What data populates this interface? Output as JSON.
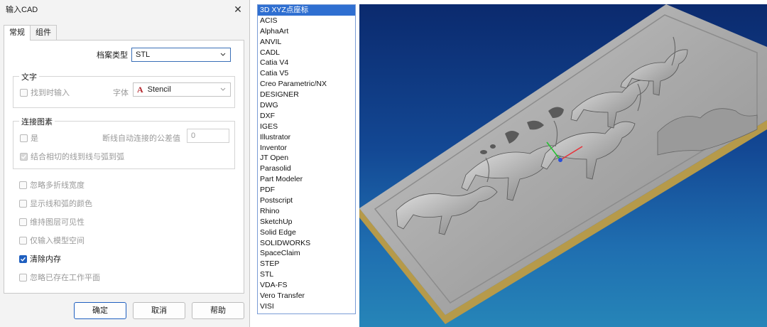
{
  "dialog": {
    "title": "输入CAD",
    "tabs": [
      {
        "label": "常规"
      },
      {
        "label": "组件"
      }
    ],
    "file_type": {
      "label": "档案类型",
      "value": "STL"
    },
    "text_group": {
      "title": "文字",
      "find_on_import": "找到时输入",
      "font_label": "字体",
      "font_value": "Stencil"
    },
    "connect_group": {
      "title": "连接图素",
      "yes": "是",
      "tolerance_label": "断线自动连接的公差值",
      "tolerance_value": "0",
      "combine_tangent": "结合相切的线到线与弧到弧"
    },
    "options": [
      {
        "label": "忽略多折线宽度",
        "checked": false
      },
      {
        "label": "显示线和弧的颜色",
        "checked": false
      },
      {
        "label": "维持图层可见性",
        "checked": false
      },
      {
        "label": "仅输入模型空间",
        "checked": false
      },
      {
        "label": "清除内存",
        "checked": true
      },
      {
        "label": "忽略已存在工作平面",
        "checked": false
      }
    ],
    "buttons": {
      "ok": "确定",
      "cancel": "取消",
      "help": "帮助"
    }
  },
  "format_list": {
    "selected_index": 0,
    "items": [
      "3D XYZ点座标",
      "ACIS",
      "AlphaArt",
      "ANVIL",
      "CADL",
      "Catia V4",
      "Catia V5",
      "Creo Parametric/NX",
      "DESIGNER",
      "DWG",
      "DXF",
      "IGES",
      "Illustrator",
      "Inventor",
      "JT Open",
      "Parasolid",
      "Part Modeler",
      "PDF",
      "Postscript",
      "Rhino",
      "SketchUp",
      "Solid Edge",
      "SOLIDWORKS",
      "SpaceClaim",
      "STEP",
      "STL",
      "VDA-FS",
      "Vero Transfer",
      "VISI"
    ]
  },
  "viewport": {
    "model": "horse-relief-plaque",
    "background_top": "#0b2a6e",
    "background_bottom": "#2685b8",
    "axis_colors": {
      "x": "#e8323a",
      "y": "#25c232",
      "z": "#2a4fd8"
    }
  }
}
